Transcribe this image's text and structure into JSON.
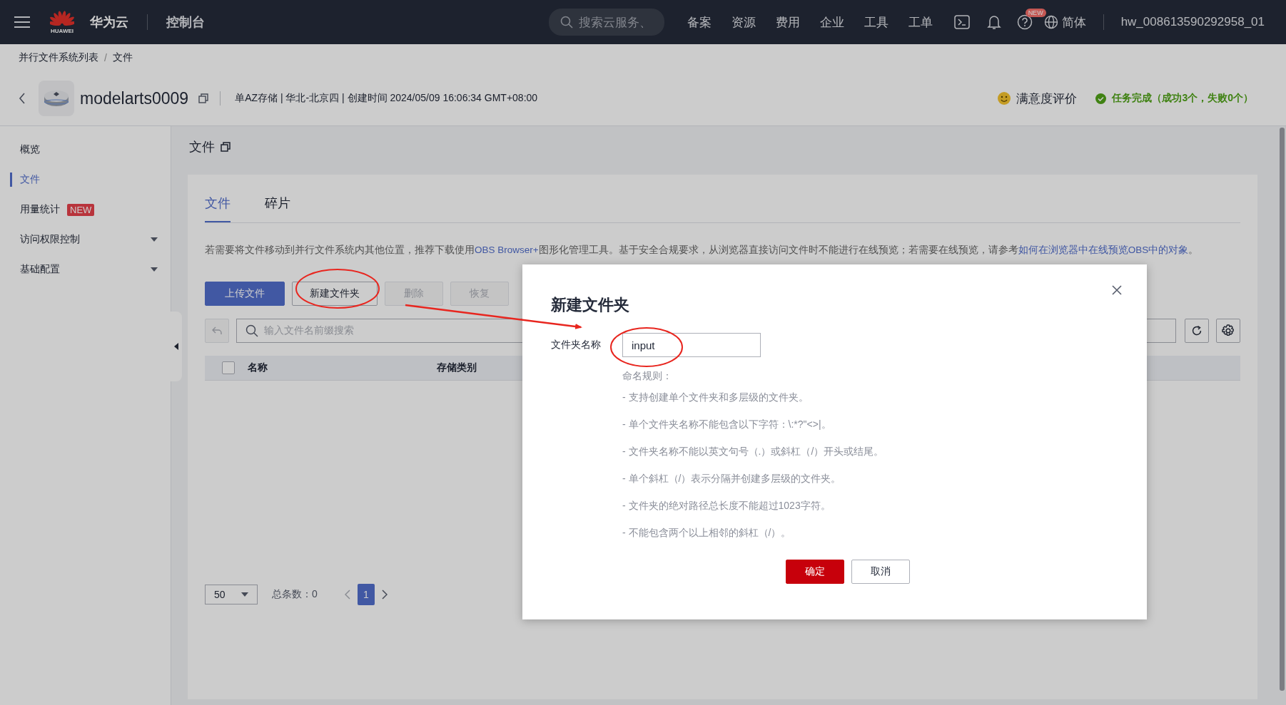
{
  "topbar": {
    "logo_text": "HUAWEI",
    "brand": "华为云",
    "console": "控制台",
    "search": {
      "placeholder": "搜索云服务、"
    },
    "nav": [
      "备案",
      "资源",
      "费用",
      "企业",
      "工具",
      "工单"
    ],
    "help_badge": "NEW",
    "language": "简体",
    "account": "hw_008613590292958_01"
  },
  "breadcrumb": {
    "separator": "/",
    "items": [
      "并行文件系统列表",
      "文件"
    ]
  },
  "header": {
    "name": "modelarts0009",
    "meta": "单AZ存储 | 华北-北京四 | 创建时间  2024/05/09 16:06:34 GMT+08:00",
    "feedback": "满意度评价",
    "task_status": "任务完成（成功3个，失败0个）"
  },
  "sidebar": {
    "items": [
      {
        "label": "概览",
        "kind": "link",
        "selected": false
      },
      {
        "label": "文件",
        "kind": "link",
        "selected": true
      },
      {
        "label": "用量统计",
        "kind": "link",
        "badge": "NEW",
        "selected": false
      },
      {
        "label": "访问权限控制",
        "kind": "group",
        "expanded": false,
        "selected": false
      },
      {
        "label": "基础配置",
        "kind": "group",
        "expanded": false,
        "selected": false
      }
    ]
  },
  "content": {
    "title": "文件",
    "tabs": [
      {
        "label": "文件",
        "selected": true
      },
      {
        "label": "碎片",
        "selected": false
      }
    ],
    "notice": [
      {
        "kind": "text",
        "text": "若需要将文件移动到并行文件系统内其他位置，推荐下载使用"
      },
      {
        "kind": "link",
        "text": "OBS Browser+"
      },
      {
        "kind": "text",
        "text": "图形化管理工具。基于安全合规要求，从浏览器直接访问文件时不能进行在线预览；若需要在线预览，请参考"
      },
      {
        "kind": "link",
        "text": "如何在浏览器中在线预览OBS中的对象"
      },
      {
        "kind": "text",
        "text": "。"
      }
    ],
    "buttons": [
      {
        "label": "上传文件",
        "kind": "primary",
        "disabled": false
      },
      {
        "label": "新建文件夹",
        "kind": "default",
        "disabled": false
      },
      {
        "label": "删除",
        "kind": "default",
        "disabled": true
      },
      {
        "label": "恢复",
        "kind": "default",
        "disabled": true
      }
    ],
    "search": {
      "placeholder": "输入文件名前缀搜索"
    },
    "table": {
      "select_all_checked": false,
      "columns": [
        "名称",
        "存储类别"
      ]
    },
    "pagination": {
      "page_size": "50",
      "total": "总条数：0",
      "pages": [
        {
          "label": "1",
          "selected": true
        }
      ]
    }
  },
  "dialog": {
    "title": "新建文件夹",
    "field_label": "文件夹名称",
    "field_value": "input",
    "rules_title": "命名规则：",
    "rules": [
      "- 支持创建单个文件夹和多层级的文件夹。",
      "- 单个文件夹名称不能包含以下字符：\\:*?\"<>|。",
      "- 文件夹名称不能以英文句号（.）或斜杠（/）开头或结尾。",
      "- 单个斜杠（/）表示分隔并创建多层级的文件夹。",
      "- 文件夹的绝对路径总长度不能超过1023字符。",
      "- 不能包含两个以上相邻的斜杠（/）。"
    ],
    "buttons": [
      {
        "label": "确定",
        "kind": "primary"
      },
      {
        "label": "取消",
        "kind": "default"
      }
    ]
  }
}
